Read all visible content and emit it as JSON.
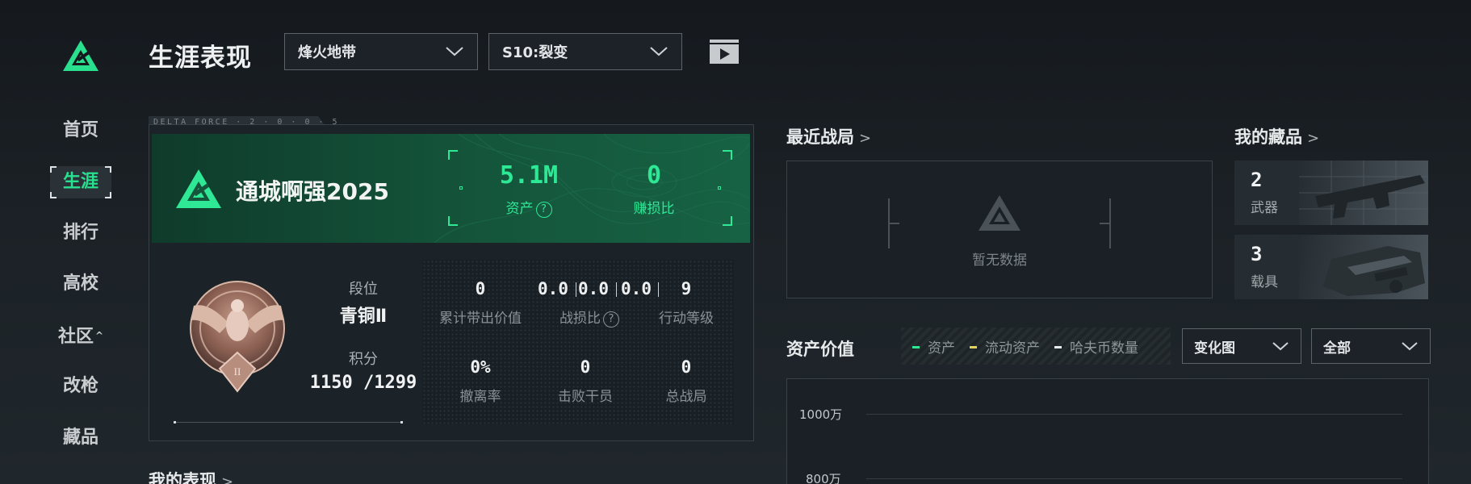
{
  "sidebar": {
    "items": [
      {
        "label": "首页"
      },
      {
        "label": "生涯"
      },
      {
        "label": "排行"
      },
      {
        "label": "高校"
      },
      {
        "label": "社区"
      },
      {
        "label": "改枪"
      },
      {
        "label": "藏品"
      }
    ],
    "active_index": 1,
    "community_caret": "^"
  },
  "header": {
    "title": "生涯表现",
    "mode_select": "烽火地带",
    "season_select": "S10:裂变"
  },
  "profile": {
    "tab_text": "DELTA FORCE · 2 · 0 · 0 · 5",
    "player_name": "通城啊强2025",
    "assets_value": "5.1M",
    "assets_label": "资产",
    "profit_ratio_value": "0",
    "profit_ratio_label": "赚损比",
    "rank_label": "段位",
    "rank_value": "青铜Ⅱ",
    "score_label": "积分",
    "score_value": "1150 /1299",
    "badge_numeral": "II",
    "stats": {
      "extracted_value": "0",
      "extracted_label": "累计带出价值",
      "kd_values": [
        "0.0",
        "0.0",
        "0.0"
      ],
      "kd_label": "战损比",
      "action_level": "9",
      "action_level_label": "行动等级",
      "escape_rate": "0%",
      "escape_rate_label": "撤离率",
      "defeated": "0",
      "defeated_label": "击败干员",
      "total_matches": "0",
      "total_matches_label": "总战局"
    }
  },
  "my_performance": {
    "title": "我的表现"
  },
  "recent_matches": {
    "title": "最近战局",
    "empty_text": "暂无数据"
  },
  "collection": {
    "title": "我的藏品",
    "items": [
      {
        "count": "2",
        "label": "武器"
      },
      {
        "count": "3",
        "label": "载具"
      }
    ]
  },
  "asset_value": {
    "title": "资产价值",
    "legend": [
      {
        "name": "资产",
        "color": "#2ee896"
      },
      {
        "name": "流动资产",
        "color": "#e2d35a"
      },
      {
        "name": "哈夫币数量",
        "color": "#e8ebec"
      }
    ],
    "chart_type_select": "变化图",
    "range_select": "全部",
    "y_ticks": [
      "1000万",
      "800万"
    ]
  },
  "colors": {
    "accent": "#2ee896",
    "background": "#1b2126",
    "banner": "#14553b"
  }
}
